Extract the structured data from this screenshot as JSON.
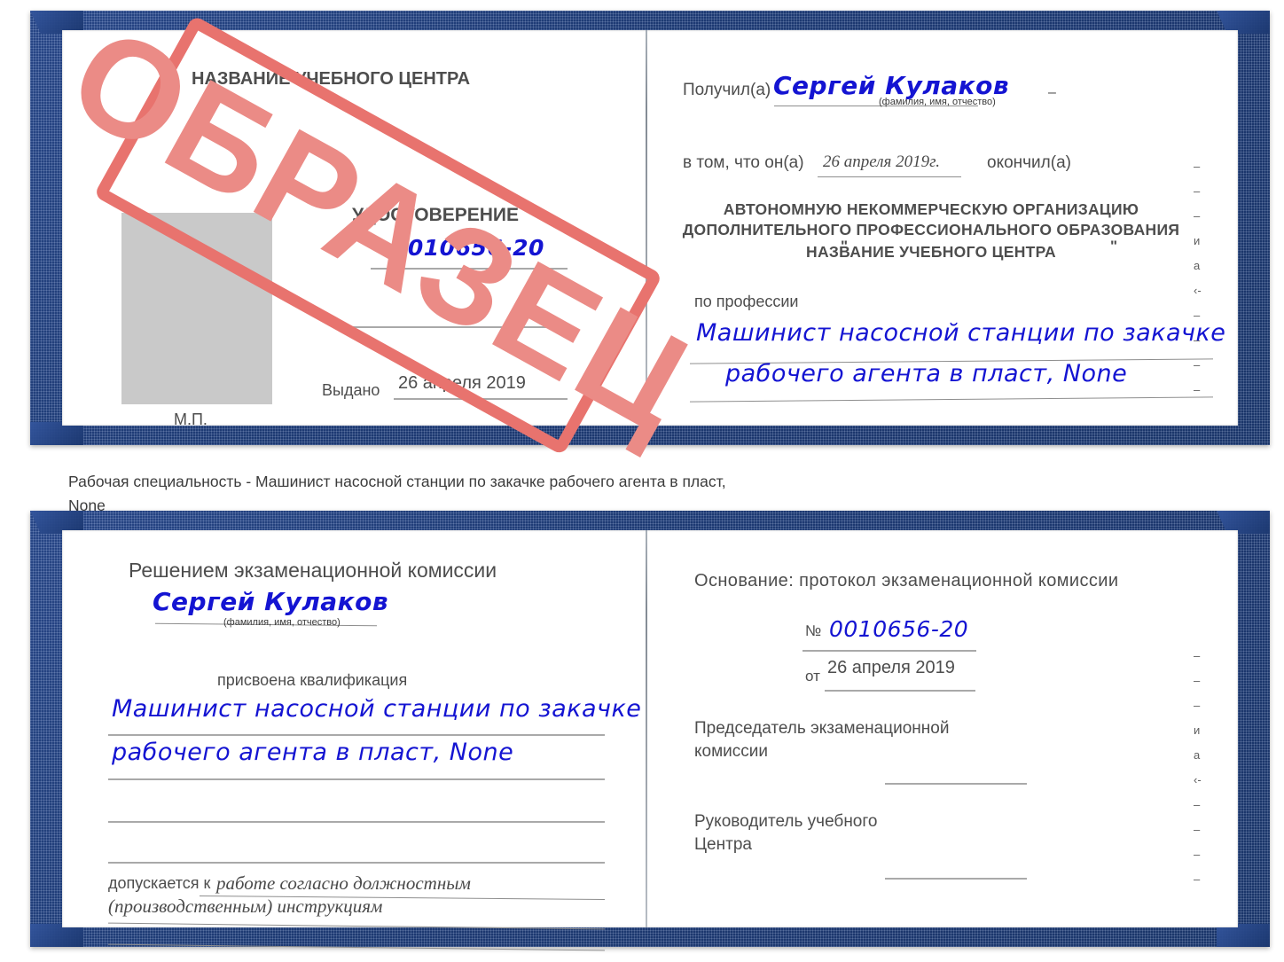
{
  "document": {
    "type": "certificate-sample",
    "stamp_label": "ОБРАЗЕЦ",
    "stamp_color": "#e8736e",
    "cover_color": "#23437f",
    "ink_color": "#1414d2",
    "print_color": "#4d4d4d"
  },
  "caption": {
    "line1": "Рабочая специальность - Машинист насосной станции по закачке рабочего агента в пласт,",
    "line2": "None"
  },
  "cert_top": {
    "left_page": {
      "center_name": "НАЗВАНИЕ УЧЕБНОГО ЦЕНТРА",
      "title": "УДОСТОВЕРЕНИЕ",
      "number_label": "№",
      "number_value": "0010656-20",
      "issued_label": "Выдано",
      "issued_value": "26 апреля 2019",
      "seal_label": "М.П."
    },
    "right_page": {
      "received_label": "Получил(а)",
      "received_value": "Сергей Кулаков",
      "fio_hint": "(фамилия, имя, отчество)",
      "statement_label": "в том, что он(а)",
      "statement_date": "26 апреля 2019г.",
      "statement_tail": "окончил(а)",
      "org_line1": "АВТОНОМНУЮ НЕКОММЕРЧЕСКУЮ ОРГАНИЗАЦИЮ",
      "org_line2": "ДОПОЛНИТЕЛЬНОГО ПРОФЕССИОНАЛЬНОГО ОБРАЗОВАНИЯ",
      "org_quote_open": "\"",
      "org_line3": "НАЗВАНИЕ УЧЕБНОГО ЦЕНТРА",
      "org_quote_close": "\"",
      "profession_label": "по профессии",
      "profession_line1": "Машинист насосной станции по закачке",
      "profession_line2": "рабочего агента в пласт, None",
      "edge_fragments": [
        "–",
        "–",
        "–",
        "и",
        "а",
        "‹-",
        "–",
        "–",
        "–",
        "–"
      ]
    }
  },
  "cert_bottom": {
    "left_page": {
      "heading": "Решением экзаменационной комиссии",
      "name_value": "Сергей Кулаков",
      "fio_hint": "(фамилия, имя, отчество)",
      "qualification_label": "присвоена квалификация",
      "qualification_line1": "Машинист насосной станции по закачке",
      "qualification_line2": "рабочего агента в пласт, None",
      "admission_label": "допускается к",
      "admission_line1": "работе согласно должностным",
      "admission_line2": "(производственным) инструкциям"
    },
    "right_page": {
      "basis_label": "Основание: протокол экзаменационной комиссии",
      "number_label": "№",
      "number_value": "0010656-20",
      "date_label": "от",
      "date_value": "26 апреля 2019",
      "chair_line1": "Председатель экзаменационной",
      "chair_line2": "комиссии",
      "head_line1": "Руководитель учебного",
      "head_line2": "Центра",
      "edge_fragments": [
        "–",
        "–",
        "–",
        "и",
        "а",
        "‹-",
        "–",
        "–",
        "–",
        "–"
      ]
    }
  }
}
